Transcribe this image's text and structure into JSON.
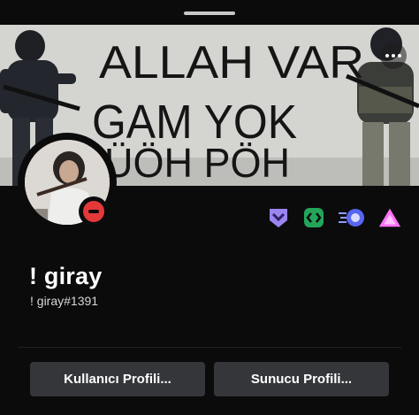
{
  "banner": {
    "graffiti_lines": [
      "ALLAH VAR",
      "GAM YOK",
      "ÜÖH PÖH"
    ]
  },
  "profile": {
    "display_name": "! giray",
    "username": "! giray#1391",
    "status": "do-not-disturb"
  },
  "badges": [
    {
      "name": "hypesquad-bravery-icon",
      "color": "#9c84ef"
    },
    {
      "name": "active-developer-icon",
      "color": "#23a55a"
    },
    {
      "name": "boost-icon",
      "color": "#5865f2"
    },
    {
      "name": "nitro-icon",
      "color": "#ff73fa"
    }
  ],
  "actions": {
    "user_profile_label": "Kullanıcı Profili...",
    "server_profile_label": "Sunucu Profili..."
  },
  "colors": {
    "background": "#0b0b0c",
    "button_bg": "#35363a",
    "dnd_red": "#e5383b"
  }
}
